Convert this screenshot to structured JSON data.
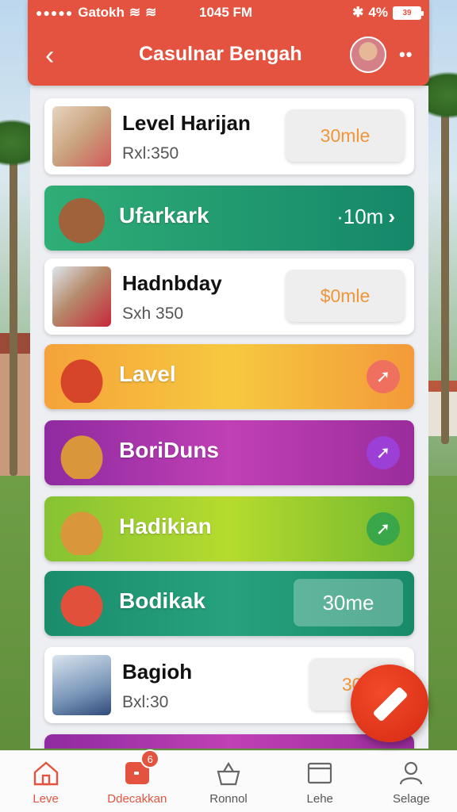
{
  "status_bar": {
    "carrier": "Gatokh",
    "time": "1045 FM",
    "battery": "4%",
    "battery_box": "39"
  },
  "header": {
    "title": "Casulnar Bengah",
    "back_icon": "chevron-left-icon",
    "more_icon": "more-dots-icon"
  },
  "list": {
    "items": [
      {
        "title": "Level Harijan",
        "subtitle": "Rxl:350",
        "value": "30mle"
      },
      {
        "title": "Ufarkark",
        "value": "·10m",
        "color": "#1f9a72"
      },
      {
        "title": "Hadnbday",
        "subtitle": "Sxh 350",
        "value": "$0mle"
      },
      {
        "title": "Lavel",
        "color": "#f0b23a"
      },
      {
        "title": "BoriDuns",
        "color": "#b036a8"
      },
      {
        "title": "Hadikian",
        "color": "#8fc838"
      },
      {
        "title": "Bodikak",
        "value": "30me",
        "color": "#1a9170"
      },
      {
        "title": "Bagioh",
        "subtitle": "Bxl:30",
        "value": "30n"
      }
    ]
  },
  "fab": {
    "icon": "pencil-icon"
  },
  "bottom_nav": {
    "items": [
      {
        "label": "Leve",
        "icon": "home-icon"
      },
      {
        "label": "Ddecakkan",
        "icon": "square-icon",
        "badge": "6"
      },
      {
        "label": "Ronnol",
        "icon": "basket-icon"
      },
      {
        "label": "Lehe",
        "icon": "folder-icon"
      },
      {
        "label": "Selage",
        "icon": "person-icon"
      }
    ]
  },
  "colors": {
    "accent": "#e4533f",
    "pill_text": "#f0963a"
  }
}
